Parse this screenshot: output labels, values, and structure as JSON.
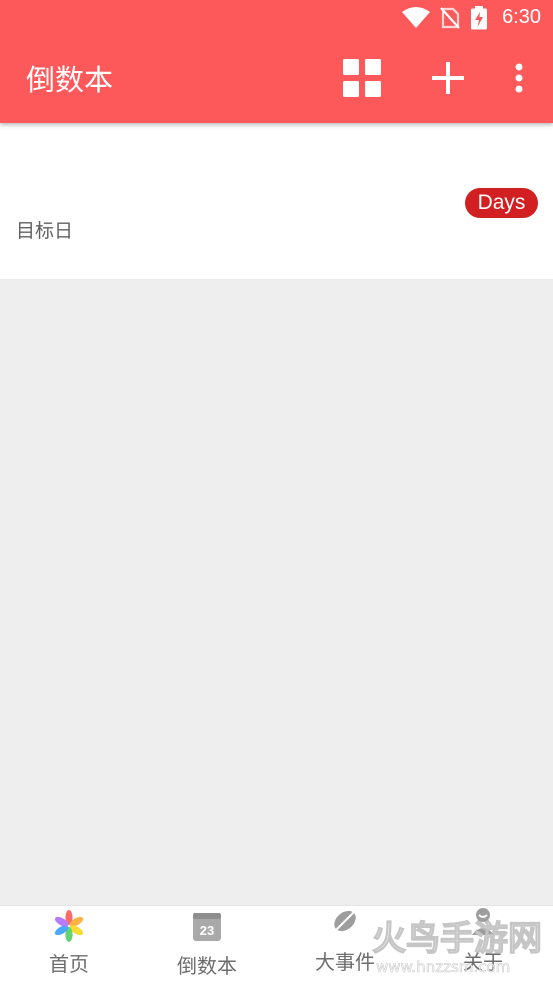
{
  "status_bar": {
    "time": "6:30",
    "icons": [
      "wifi-icon",
      "no-sim-icon",
      "battery-charging-icon"
    ]
  },
  "toolbar": {
    "title": "倒数本",
    "actions": [
      "grid-view-icon",
      "add-icon",
      "more-vert-icon"
    ]
  },
  "event_card": {
    "label": "目标日",
    "badge": "Days"
  },
  "bottom_nav": {
    "items": [
      {
        "label": "首页",
        "icon": "pinwheel-icon"
      },
      {
        "label": "倒数本",
        "icon": "calendar-23-icon",
        "badge_text": "23"
      },
      {
        "label": "大事件",
        "icon": "leaf-icon"
      },
      {
        "label": "关于",
        "icon": "person-icon"
      }
    ]
  },
  "watermark": {
    "text": "火鸟手游网",
    "url": "www.hnzzsm.com"
  },
  "colors": {
    "primary": "#fd595b",
    "badge": "#d21f21",
    "background": "#eeeeee"
  }
}
